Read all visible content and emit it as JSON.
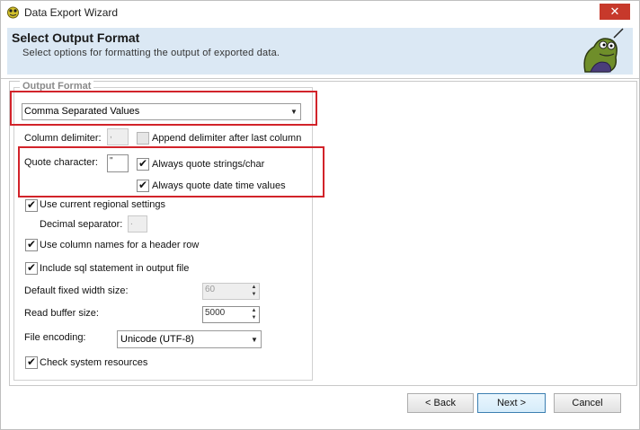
{
  "window": {
    "title": "Data Export Wizard",
    "close_symbol": "✕"
  },
  "header": {
    "title": "Select Output Format",
    "subtitle": "Select options for formatting the output of exported data."
  },
  "output_format": {
    "group_label": "Output Format",
    "format_selected": "Comma Separated Values",
    "column_delimiter_label": "Column delimiter:",
    "column_delimiter_value": ",",
    "append_delimiter_label": "Append delimiter after last column",
    "append_delimiter_checked": false,
    "quote_character_label": "Quote character:",
    "quote_character_value": "\"",
    "always_quote_strings_label": "Always quote strings/char",
    "always_quote_strings_checked": true,
    "always_quote_datetime_label": "Always quote date time values",
    "always_quote_datetime_checked": true,
    "use_regional_label": "Use current regional settings",
    "use_regional_checked": true,
    "decimal_separator_label": "Decimal separator:",
    "decimal_separator_value": ".",
    "use_column_names_label": "Use column names for a header row",
    "use_column_names_checked": true,
    "include_sql_label": "Include sql statement in output file",
    "include_sql_checked": true,
    "fixed_width_label": "Default fixed width size:",
    "fixed_width_value": "60",
    "read_buffer_label": "Read buffer size:",
    "read_buffer_value": "5000",
    "file_encoding_label": "File encoding:",
    "file_encoding_value": "Unicode (UTF-8)",
    "check_resources_label": "Check system resources",
    "check_resources_checked": true
  },
  "buttons": {
    "back": "< Back",
    "next": "Next >",
    "cancel": "Cancel"
  },
  "colors": {
    "highlight_red": "#d2232a",
    "header_band": "#dbe8f4",
    "close_red": "#c7392b"
  }
}
